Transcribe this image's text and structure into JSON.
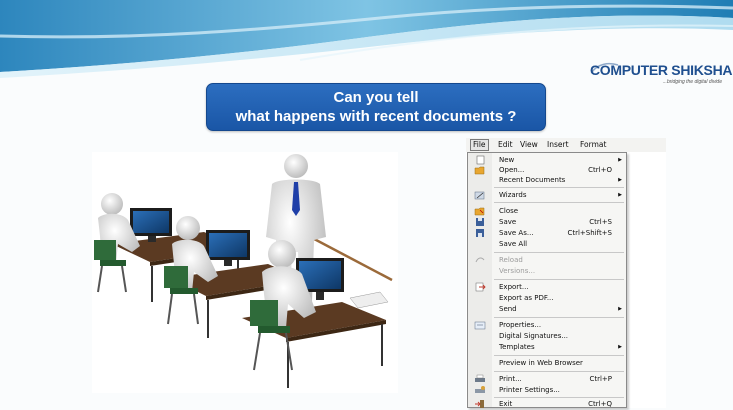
{
  "banner": {
    "line1": "Can you tell",
    "line2": "what happens with recent documents ?"
  },
  "logo": {
    "name": "COMPUTER SHIKSHA",
    "tagline": "...bridging the digital divide"
  },
  "menubar": {
    "items": [
      "File",
      "Edit",
      "View",
      "Insert",
      "Format"
    ]
  },
  "file_menu": {
    "items": [
      {
        "label": "New",
        "shortcut": "",
        "submenu": true,
        "icon": "new-document-icon",
        "enabled": true
      },
      {
        "label": "Open...",
        "shortcut": "Ctrl+O",
        "submenu": false,
        "icon": "open-folder-icon",
        "enabled": true
      },
      {
        "label": "Recent Documents",
        "shortcut": "",
        "submenu": true,
        "icon": "",
        "enabled": true
      },
      {
        "label": "Wizards",
        "shortcut": "",
        "submenu": true,
        "icon": "wizard-icon",
        "enabled": true
      },
      {
        "label": "Close",
        "shortcut": "",
        "submenu": false,
        "icon": "close-folder-icon",
        "enabled": true
      },
      {
        "label": "Save",
        "shortcut": "Ctrl+S",
        "submenu": false,
        "icon": "save-icon",
        "enabled": true
      },
      {
        "label": "Save As...",
        "shortcut": "Ctrl+Shift+S",
        "submenu": false,
        "icon": "save-as-icon",
        "enabled": true
      },
      {
        "label": "Save All",
        "shortcut": "",
        "submenu": false,
        "icon": "",
        "enabled": true
      },
      {
        "label": "Reload",
        "shortcut": "",
        "submenu": false,
        "icon": "reload-icon",
        "enabled": false
      },
      {
        "label": "Versions...",
        "shortcut": "",
        "submenu": false,
        "icon": "",
        "enabled": false
      },
      {
        "label": "Export...",
        "shortcut": "",
        "submenu": false,
        "icon": "export-icon",
        "enabled": true
      },
      {
        "label": "Export as PDF...",
        "shortcut": "",
        "submenu": false,
        "icon": "",
        "enabled": true
      },
      {
        "label": "Send",
        "shortcut": "",
        "submenu": true,
        "icon": "",
        "enabled": true
      },
      {
        "label": "Properties...",
        "shortcut": "",
        "submenu": false,
        "icon": "properties-icon",
        "enabled": true
      },
      {
        "label": "Digital Signatures...",
        "shortcut": "",
        "submenu": false,
        "icon": "",
        "enabled": true
      },
      {
        "label": "Templates",
        "shortcut": "",
        "submenu": true,
        "icon": "",
        "enabled": true
      },
      {
        "label": "Preview in Web Browser",
        "shortcut": "",
        "submenu": false,
        "icon": "",
        "enabled": true
      },
      {
        "label": "Print...",
        "shortcut": "Ctrl+P",
        "submenu": false,
        "icon": "print-icon",
        "enabled": true
      },
      {
        "label": "Printer Settings...",
        "shortcut": "",
        "submenu": false,
        "icon": "printer-settings-icon",
        "enabled": true
      },
      {
        "label": "Exit",
        "shortcut": "Ctrl+Q",
        "submenu": false,
        "icon": "exit-icon",
        "enabled": true
      }
    ]
  },
  "colors": {
    "banner_blue": "#1f5fb0",
    "logo_blue": "#1f4f8f",
    "wave_light": "#bfe3f2",
    "wave_dark": "#2f8fc2"
  }
}
